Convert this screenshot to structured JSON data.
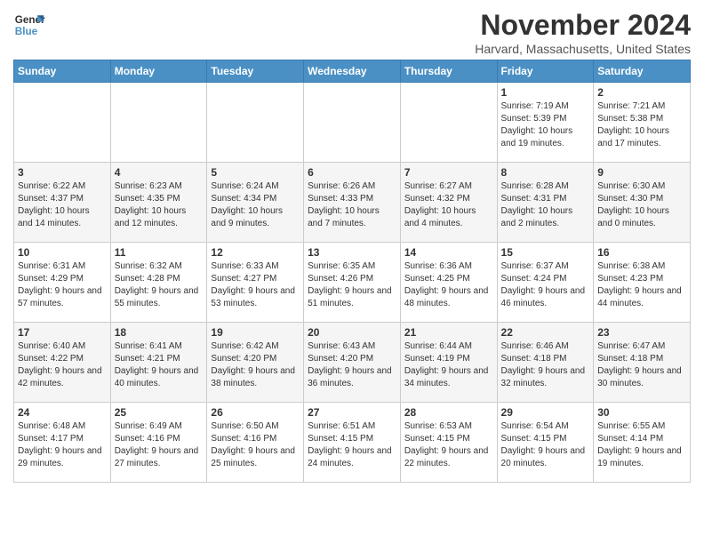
{
  "logo": {
    "line1": "General",
    "line2": "Blue"
  },
  "title": "November 2024",
  "location": "Harvard, Massachusetts, United States",
  "days_of_week": [
    "Sunday",
    "Monday",
    "Tuesday",
    "Wednesday",
    "Thursday",
    "Friday",
    "Saturday"
  ],
  "weeks": [
    [
      {
        "day": "",
        "info": ""
      },
      {
        "day": "",
        "info": ""
      },
      {
        "day": "",
        "info": ""
      },
      {
        "day": "",
        "info": ""
      },
      {
        "day": "",
        "info": ""
      },
      {
        "day": "1",
        "info": "Sunrise: 7:19 AM\nSunset: 5:39 PM\nDaylight: 10 hours and 19 minutes."
      },
      {
        "day": "2",
        "info": "Sunrise: 7:21 AM\nSunset: 5:38 PM\nDaylight: 10 hours and 17 minutes."
      }
    ],
    [
      {
        "day": "3",
        "info": "Sunrise: 6:22 AM\nSunset: 4:37 PM\nDaylight: 10 hours and 14 minutes."
      },
      {
        "day": "4",
        "info": "Sunrise: 6:23 AM\nSunset: 4:35 PM\nDaylight: 10 hours and 12 minutes."
      },
      {
        "day": "5",
        "info": "Sunrise: 6:24 AM\nSunset: 4:34 PM\nDaylight: 10 hours and 9 minutes."
      },
      {
        "day": "6",
        "info": "Sunrise: 6:26 AM\nSunset: 4:33 PM\nDaylight: 10 hours and 7 minutes."
      },
      {
        "day": "7",
        "info": "Sunrise: 6:27 AM\nSunset: 4:32 PM\nDaylight: 10 hours and 4 minutes."
      },
      {
        "day": "8",
        "info": "Sunrise: 6:28 AM\nSunset: 4:31 PM\nDaylight: 10 hours and 2 minutes."
      },
      {
        "day": "9",
        "info": "Sunrise: 6:30 AM\nSunset: 4:30 PM\nDaylight: 10 hours and 0 minutes."
      }
    ],
    [
      {
        "day": "10",
        "info": "Sunrise: 6:31 AM\nSunset: 4:29 PM\nDaylight: 9 hours and 57 minutes."
      },
      {
        "day": "11",
        "info": "Sunrise: 6:32 AM\nSunset: 4:28 PM\nDaylight: 9 hours and 55 minutes."
      },
      {
        "day": "12",
        "info": "Sunrise: 6:33 AM\nSunset: 4:27 PM\nDaylight: 9 hours and 53 minutes."
      },
      {
        "day": "13",
        "info": "Sunrise: 6:35 AM\nSunset: 4:26 PM\nDaylight: 9 hours and 51 minutes."
      },
      {
        "day": "14",
        "info": "Sunrise: 6:36 AM\nSunset: 4:25 PM\nDaylight: 9 hours and 48 minutes."
      },
      {
        "day": "15",
        "info": "Sunrise: 6:37 AM\nSunset: 4:24 PM\nDaylight: 9 hours and 46 minutes."
      },
      {
        "day": "16",
        "info": "Sunrise: 6:38 AM\nSunset: 4:23 PM\nDaylight: 9 hours and 44 minutes."
      }
    ],
    [
      {
        "day": "17",
        "info": "Sunrise: 6:40 AM\nSunset: 4:22 PM\nDaylight: 9 hours and 42 minutes."
      },
      {
        "day": "18",
        "info": "Sunrise: 6:41 AM\nSunset: 4:21 PM\nDaylight: 9 hours and 40 minutes."
      },
      {
        "day": "19",
        "info": "Sunrise: 6:42 AM\nSunset: 4:20 PM\nDaylight: 9 hours and 38 minutes."
      },
      {
        "day": "20",
        "info": "Sunrise: 6:43 AM\nSunset: 4:20 PM\nDaylight: 9 hours and 36 minutes."
      },
      {
        "day": "21",
        "info": "Sunrise: 6:44 AM\nSunset: 4:19 PM\nDaylight: 9 hours and 34 minutes."
      },
      {
        "day": "22",
        "info": "Sunrise: 6:46 AM\nSunset: 4:18 PM\nDaylight: 9 hours and 32 minutes."
      },
      {
        "day": "23",
        "info": "Sunrise: 6:47 AM\nSunset: 4:18 PM\nDaylight: 9 hours and 30 minutes."
      }
    ],
    [
      {
        "day": "24",
        "info": "Sunrise: 6:48 AM\nSunset: 4:17 PM\nDaylight: 9 hours and 29 minutes."
      },
      {
        "day": "25",
        "info": "Sunrise: 6:49 AM\nSunset: 4:16 PM\nDaylight: 9 hours and 27 minutes."
      },
      {
        "day": "26",
        "info": "Sunrise: 6:50 AM\nSunset: 4:16 PM\nDaylight: 9 hours and 25 minutes."
      },
      {
        "day": "27",
        "info": "Sunrise: 6:51 AM\nSunset: 4:15 PM\nDaylight: 9 hours and 24 minutes."
      },
      {
        "day": "28",
        "info": "Sunrise: 6:53 AM\nSunset: 4:15 PM\nDaylight: 9 hours and 22 minutes."
      },
      {
        "day": "29",
        "info": "Sunrise: 6:54 AM\nSunset: 4:15 PM\nDaylight: 9 hours and 20 minutes."
      },
      {
        "day": "30",
        "info": "Sunrise: 6:55 AM\nSunset: 4:14 PM\nDaylight: 9 hours and 19 minutes."
      }
    ]
  ]
}
